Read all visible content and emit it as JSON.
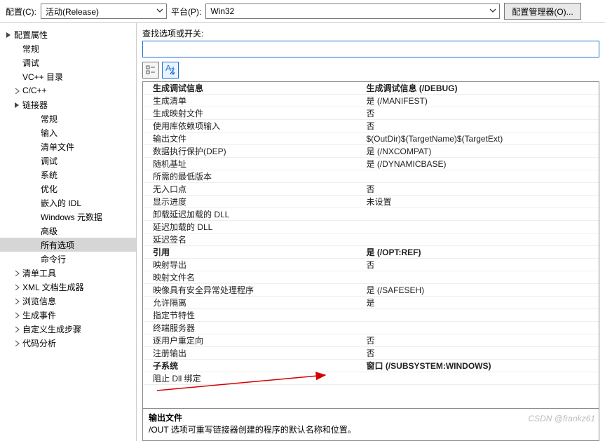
{
  "topbar": {
    "config_label": "配置(C):",
    "config_value": "活动(Release)",
    "platform_label": "平台(P):",
    "platform_value": "Win32",
    "manager_button": "配置管理器(O)..."
  },
  "tree": {
    "root": "配置属性",
    "items": [
      {
        "label": "常规",
        "level": 2,
        "expandable": false
      },
      {
        "label": "调试",
        "level": 2,
        "expandable": false
      },
      {
        "label": "VC++ 目录",
        "level": 2,
        "expandable": false
      },
      {
        "label": "C/C++",
        "level": 2,
        "expandable": true,
        "expanded": false
      },
      {
        "label": "链接器",
        "level": 2,
        "expandable": true,
        "expanded": true
      },
      {
        "label": "常规",
        "level": 3
      },
      {
        "label": "输入",
        "level": 3
      },
      {
        "label": "清单文件",
        "level": 3
      },
      {
        "label": "调试",
        "level": 3
      },
      {
        "label": "系统",
        "level": 3
      },
      {
        "label": "优化",
        "level": 3
      },
      {
        "label": "嵌入的 IDL",
        "level": 3
      },
      {
        "label": "Windows 元数据",
        "level": 3
      },
      {
        "label": "高级",
        "level": 3
      },
      {
        "label": "所有选项",
        "level": 3,
        "selected": true
      },
      {
        "label": "命令行",
        "level": 3
      },
      {
        "label": "清单工具",
        "level": 2,
        "expandable": true,
        "expanded": false
      },
      {
        "label": "XML 文档生成器",
        "level": 2,
        "expandable": true,
        "expanded": false
      },
      {
        "label": "浏览信息",
        "level": 2,
        "expandable": true,
        "expanded": false
      },
      {
        "label": "生成事件",
        "level": 2,
        "expandable": true,
        "expanded": false
      },
      {
        "label": "自定义生成步骤",
        "level": 2,
        "expandable": true,
        "expanded": false
      },
      {
        "label": "代码分析",
        "level": 2,
        "expandable": true,
        "expanded": false
      }
    ]
  },
  "search": {
    "label": "查找选项或开关:",
    "value": ""
  },
  "grid_rows": [
    {
      "name": "生成调试信息",
      "value": "生成调试信息 (/DEBUG)",
      "bold": true
    },
    {
      "name": "生成清单",
      "value": "是 (/MANIFEST)"
    },
    {
      "name": "生成映射文件",
      "value": "否"
    },
    {
      "name": "使用库依赖项输入",
      "value": "否"
    },
    {
      "name": "输出文件",
      "value": "$(OutDir)$(TargetName)$(TargetExt)"
    },
    {
      "name": "数据执行保护(DEP)",
      "value": "是 (/NXCOMPAT)"
    },
    {
      "name": "随机基址",
      "value": "是 (/DYNAMICBASE)"
    },
    {
      "name": "所需的最低版本",
      "value": ""
    },
    {
      "name": "无入口点",
      "value": "否"
    },
    {
      "name": "显示进度",
      "value": "未设置"
    },
    {
      "name": "卸载延迟加载的 DLL",
      "value": ""
    },
    {
      "name": "延迟加载的 DLL",
      "value": ""
    },
    {
      "name": "延迟签名",
      "value": ""
    },
    {
      "name": "引用",
      "value": "是 (/OPT:REF)",
      "bold": true
    },
    {
      "name": "映射导出",
      "value": "否"
    },
    {
      "name": "映射文件名",
      "value": ""
    },
    {
      "name": "映像具有安全异常处理程序",
      "value": "是 (/SAFESEH)"
    },
    {
      "name": "允许隔离",
      "value": "是"
    },
    {
      "name": "指定节特性",
      "value": ""
    },
    {
      "name": "终端服务器",
      "value": ""
    },
    {
      "name": "逐用户重定向",
      "value": "否"
    },
    {
      "name": "注册输出",
      "value": "否"
    },
    {
      "name": "子系统",
      "value": "窗口 (/SUBSYSTEM:WINDOWS)",
      "bold": true
    },
    {
      "name": "阻止 Dll 绑定",
      "value": ""
    }
  ],
  "description": {
    "title": "输出文件",
    "body": "/OUT 选项可重写链接器创建的程序的默认名称和位置。"
  },
  "watermark": "CSDN @frankz61"
}
